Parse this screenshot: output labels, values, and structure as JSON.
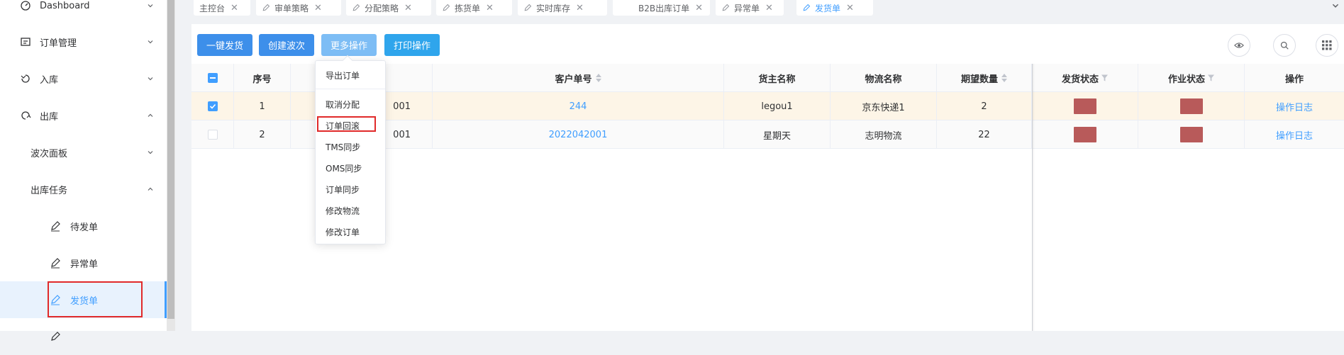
{
  "sidebar": {
    "items": [
      {
        "label": "Dashboard",
        "icon": "dashboard-icon"
      },
      {
        "label": "订单管理",
        "icon": "order-icon"
      },
      {
        "label": "入库",
        "icon": "inbound-icon"
      },
      {
        "label": "出库",
        "icon": "outbound-icon"
      },
      {
        "label": "波次面板"
      },
      {
        "label": "出库任务"
      },
      {
        "label": "待发单",
        "icon": "edit-icon"
      },
      {
        "label": "异常单",
        "icon": "edit-icon"
      },
      {
        "label": "发货单",
        "icon": "edit-icon"
      }
    ]
  },
  "tabs": [
    {
      "label": "主控台"
    },
    {
      "label": "审单策略"
    },
    {
      "label": "分配策略"
    },
    {
      "label": "拣货单"
    },
    {
      "label": "实时库存"
    },
    {
      "label": "B2B出库订单"
    },
    {
      "label": "异常单"
    },
    {
      "label": "发货单"
    }
  ],
  "toolbar": {
    "ship": "一键发货",
    "wave": "创建波次",
    "more": "更多操作",
    "print": "打印操作"
  },
  "dropdown": {
    "items": [
      "导出订单",
      "取消分配",
      "订单回滚",
      "TMS同步",
      "OMS同步",
      "订单同步",
      "修改物流",
      "修改订单"
    ]
  },
  "table": {
    "headers": {
      "seq": "序号",
      "customer_no": "客户单号",
      "owner": "货主名称",
      "logistics": "物流名称",
      "qty": "期望数量",
      "ship_status": "发货状态",
      "work_status": "作业状态",
      "ops": "操作"
    },
    "rows": [
      {
        "seq": "1",
        "order_no_tail": "001",
        "customer_no": "244",
        "owner": "legou1",
        "logistics": "京东快递1",
        "qty": "2",
        "op": "操作日志"
      },
      {
        "seq": "2",
        "order_no_tail": "001",
        "customer_no": "2022042001",
        "owner": "星期天",
        "logistics": "志明物流",
        "qty": "22",
        "op": "操作日志"
      }
    ]
  },
  "colors": {
    "primary": "#409eff",
    "badge": "#b85a5a",
    "highlight": "#e02a2a",
    "selected_row": "#fdf5e7"
  }
}
